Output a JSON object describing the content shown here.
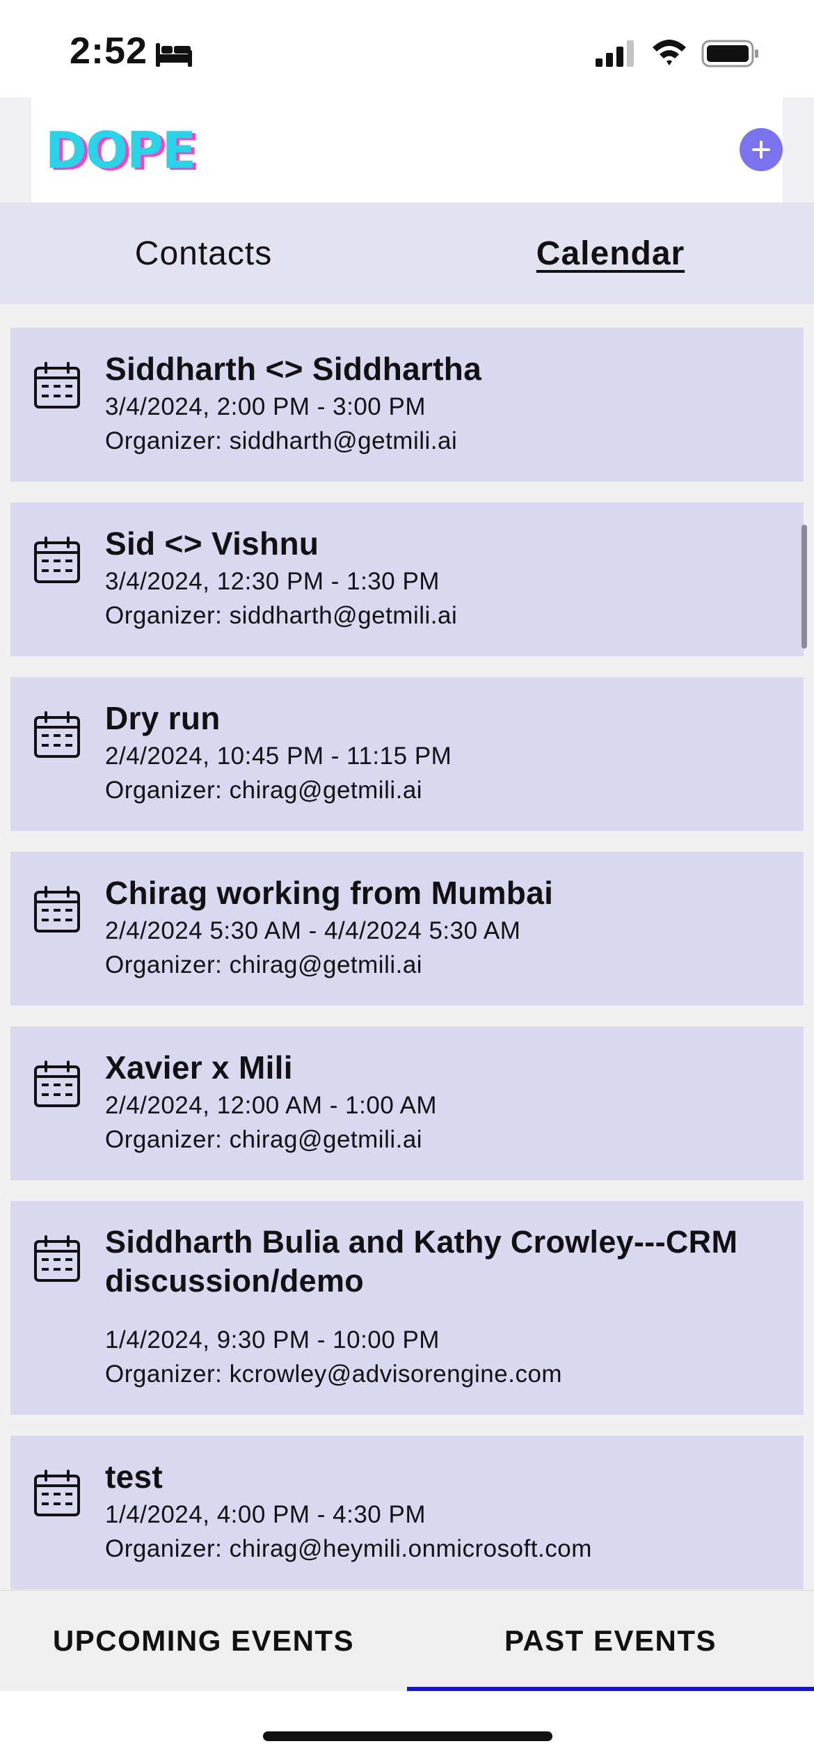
{
  "status_bar": {
    "time": "2:52",
    "icons": [
      "bed-icon",
      "signal-icon",
      "wifi-icon",
      "battery-icon"
    ]
  },
  "header": {
    "logo_text": "DOPE",
    "add_icon": "plus-circle-icon"
  },
  "top_tabs": [
    {
      "label": "Contacts",
      "active": false
    },
    {
      "label": "Calendar",
      "active": true
    }
  ],
  "events": [
    {
      "title": "Siddharth <> Siddhartha",
      "time": "3/4/2024, 2:00 PM  -  3:00 PM",
      "organizer": "Organizer: siddharth@getmili.ai"
    },
    {
      "title": "Sid <> Vishnu",
      "time": "3/4/2024, 12:30 PM  -  1:30 PM",
      "organizer": "Organizer: siddharth@getmili.ai"
    },
    {
      "title": "Dry run",
      "time": "2/4/2024, 10:45 PM  -  11:15 PM",
      "organizer": "Organizer: chirag@getmili.ai"
    },
    {
      "title": "Chirag working from Mumbai",
      "time": "2/4/2024 5:30 AM  -  4/4/2024 5:30 AM",
      "organizer": "Organizer: chirag@getmili.ai"
    },
    {
      "title": "Xavier x Mili",
      "time": "2/4/2024, 12:00 AM  -  1:00 AM",
      "organizer": "Organizer: chirag@getmili.ai"
    },
    {
      "title": "Siddharth Bulia and Kathy Crowley---CRM discussion/demo",
      "time": "1/4/2024, 9:30 PM  -  10:00 PM",
      "organizer": "Organizer: kcrowley@advisorengine.com"
    },
    {
      "title": "test",
      "time": "1/4/2024, 4:00 PM  -  4:30 PM",
      "organizer": "Organizer: chirag@heymili.onmicrosoft.com"
    }
  ],
  "bottom_tabs": [
    {
      "label": "UPCOMING EVENTS",
      "active": false
    },
    {
      "label": "PAST EVENTS",
      "active": true
    }
  ],
  "colors": {
    "card_bg": "#d9d8f1",
    "tab_bar_bg": "#e3e2f1",
    "accent": "#7b72ee",
    "active_indicator": "#1515d6"
  }
}
